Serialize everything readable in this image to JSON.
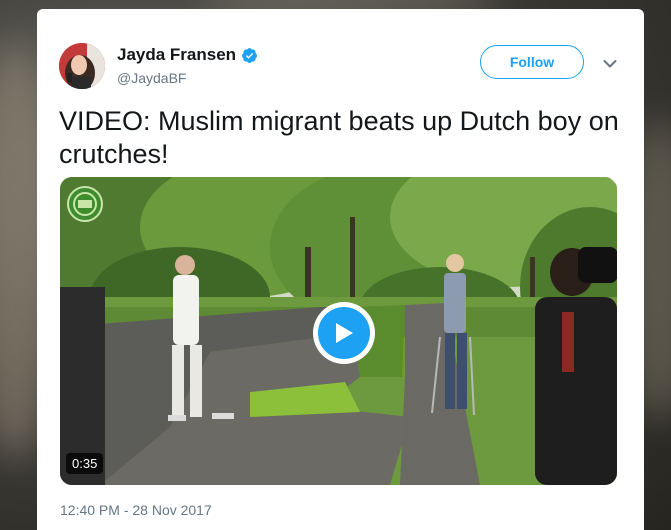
{
  "tweet": {
    "display_name": "Jayda Fransen",
    "handle": "@JaydaBF",
    "verified": true,
    "follow_label": "Follow",
    "text": "VIDEO: Muslim migrant beats up Dutch boy on crutches!",
    "timestamp": "12:40 PM - 28 Nov 2017"
  },
  "media": {
    "type": "video",
    "duration": "0:35"
  },
  "icons": {
    "verified": "verified-badge-icon",
    "more": "chevron-down-icon",
    "play": "play-icon"
  },
  "colors": {
    "accent": "#1da1f2",
    "text_primary": "#14171a",
    "text_secondary": "#657786",
    "card_bg": "#ffffff"
  }
}
